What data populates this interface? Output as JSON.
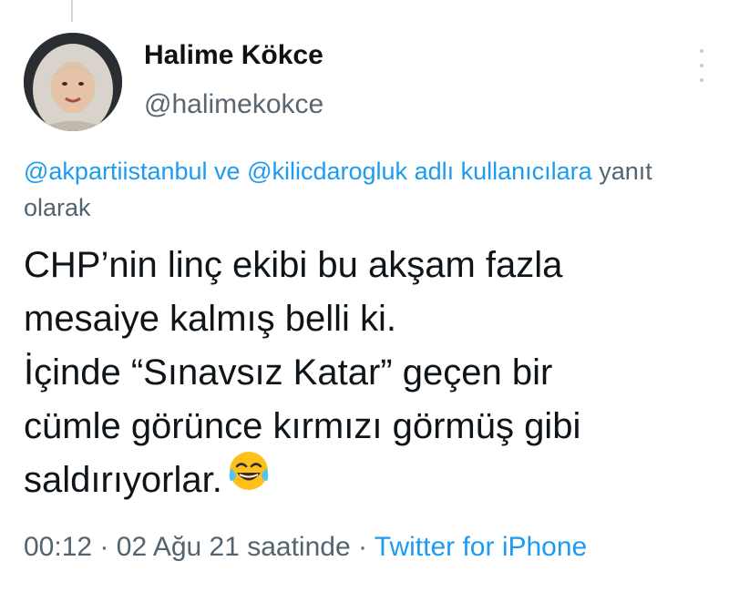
{
  "tweet": {
    "author_name": "Halime Kökce",
    "author_handle": "@halimekokce",
    "avatar": "avatar-headscarf-woman",
    "reply_context": {
      "mention_1": "@akpartiistanbul",
      "connector": "ve",
      "mention_2": "@kilicdarogluk",
      "suffix_link": "adlı kullanıcılara",
      "suffix_text": "yanıt olarak"
    },
    "text_lines": [
      "CHP’nin linç ekibi bu akşam fazla",
      "mesaiye kalmış belli ki.",
      "İçinde “Sınavsız Katar” geçen bir",
      "cümle görünce kırmızı görmüş gibi",
      "saldırıyorlar."
    ],
    "emoji": "face-with-tears-of-joy",
    "time": "00:12",
    "separator": "·",
    "date": "02 Ağu 21 saatinde",
    "source": "Twitter for iPhone"
  },
  "colors": {
    "link": "#1d9bf0",
    "secondary": "#536471",
    "primary_text": "#0f1419"
  }
}
